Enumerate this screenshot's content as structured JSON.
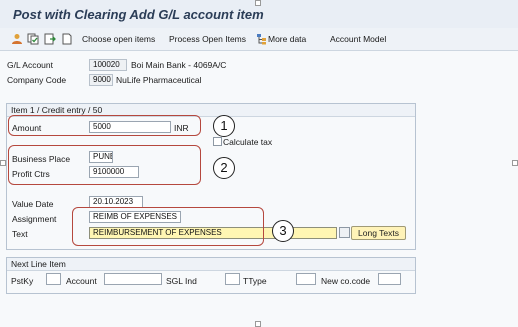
{
  "window": {
    "title": "Post with Clearing Add G/L account item"
  },
  "toolbar": {
    "icons": [
      "person-icon",
      "copy-icon",
      "overview-icon",
      "document-icon"
    ],
    "items": [
      "Choose open items",
      "Process Open Items",
      "More data",
      "Account Model"
    ],
    "more_data_icon": "tree-icon"
  },
  "header": {
    "gl_account_label": "G/L Account",
    "gl_account_value": "100020",
    "gl_account_desc": "Boi Main Bank - 4069A/C",
    "company_code_label": "Company Code",
    "company_code_value": "9000",
    "company_code_desc": "NuLife Pharmaceutical"
  },
  "item": {
    "group_title": "Item 1 / Credit entry / 50",
    "amount_label": "Amount",
    "amount_value": "5000",
    "currency": "INR",
    "calc_tax_label": "Calculate tax",
    "calc_tax_checked": false,
    "business_place_label": "Business Place",
    "business_place_value": "PUNE",
    "profit_ctr_label": "Profit Ctrs",
    "profit_ctr_value": "9100000",
    "value_date_label": "Value Date",
    "value_date_value": "20.10.2023",
    "assignment_label": "Assignment",
    "assignment_value": "REIMB OF EXPENSES",
    "text_label": "Text",
    "text_value": "REIMBURSEMENT OF EXPENSES",
    "long_texts_label": "Long Texts"
  },
  "annotations": [
    "1",
    "2",
    "3"
  ],
  "next_line": {
    "group_title": "Next Line Item",
    "pstky_label": "PstKy",
    "pstky_value": "",
    "account_label": "Account",
    "account_value": "",
    "sgl_label": "SGL Ind",
    "sgl_value": "",
    "ttype_label": "TType",
    "ttype_value": "",
    "new_cocode_label": "New co.code",
    "new_cocode_value": ""
  },
  "colors": {
    "annotation_border": "#b5483e",
    "highlight_field": "#fff6b3",
    "title_text": "#2b3d57"
  }
}
